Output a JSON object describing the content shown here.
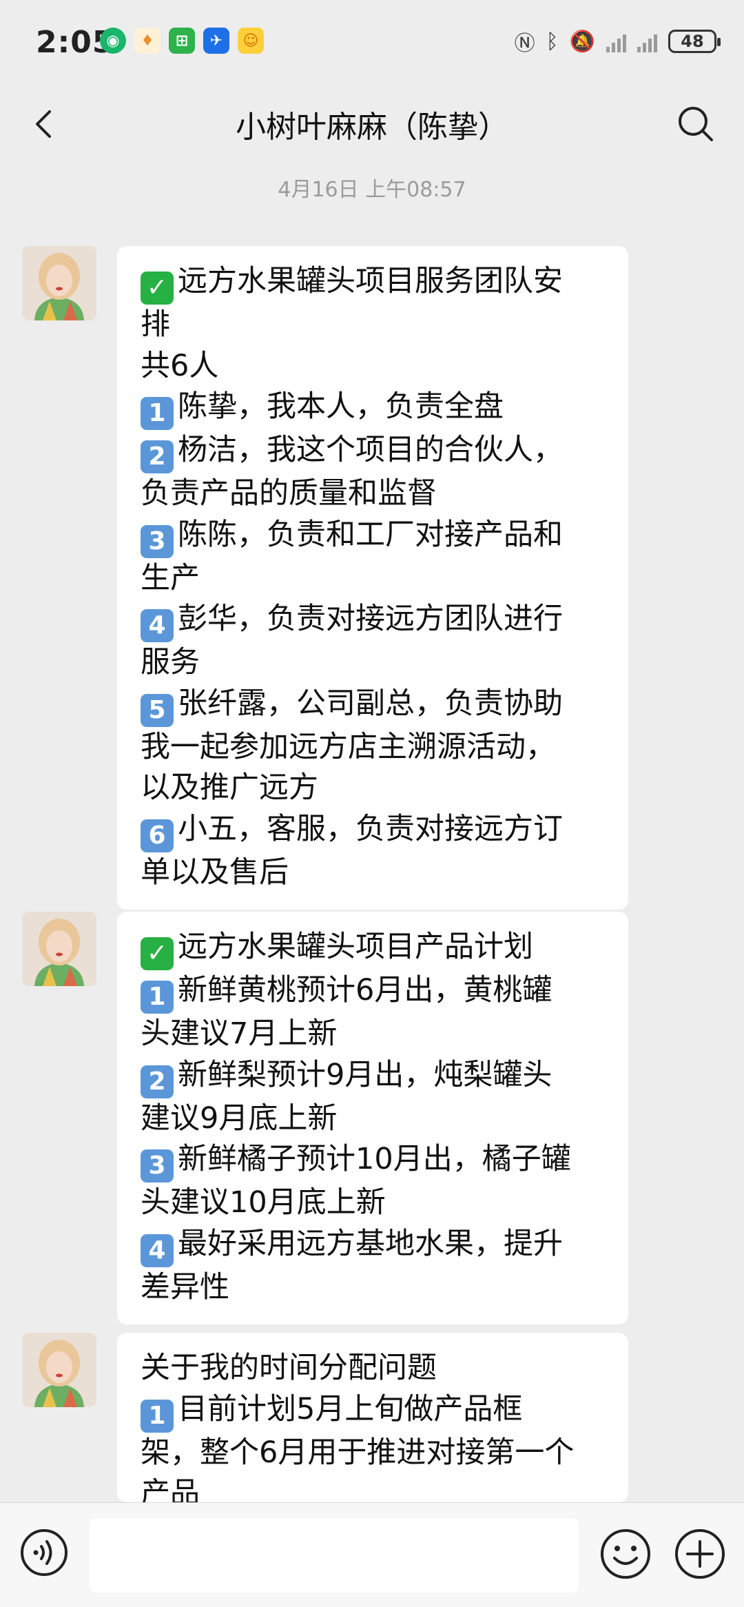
{
  "status_bar": {
    "time": "2:05",
    "battery": "48",
    "app_icons": [
      "green-circle-app-icon",
      "gold-app-icon",
      "green-app-icon",
      "blue-plane-app-icon",
      "yellow-app-icon"
    ]
  },
  "header": {
    "title": "小树叶麻麻（陈挚）"
  },
  "timestamp": "4月16日 上午08:57",
  "messages": [
    {
      "lines": [
        {
          "icon": "✓",
          "kind": "check",
          "text": "远方水果罐头项目服务团队安"
        },
        {
          "text": "排"
        },
        {
          "text": "共6人"
        },
        {
          "icon": "1",
          "kind": "num",
          "text": "陈挚，我本人，负责全盘"
        },
        {
          "icon": "2",
          "kind": "num",
          "text": "杨洁，我这个项目的合伙人，"
        },
        {
          "text": "负责产品的质量和监督"
        },
        {
          "icon": "3",
          "kind": "num",
          "text": "陈陈，负责和工厂对接产品和"
        },
        {
          "text": "生产"
        },
        {
          "icon": "4",
          "kind": "num",
          "text": "彭华，负责对接远方团队进行"
        },
        {
          "text": "服务"
        },
        {
          "icon": "5",
          "kind": "num",
          "text": "张纤露，公司副总，负责协助"
        },
        {
          "text": "我一起参加远方店主溯源活动，"
        },
        {
          "text": "以及推广远方"
        },
        {
          "icon": "6",
          "kind": "num",
          "text": "小五，客服，负责对接远方订"
        },
        {
          "text": "单以及售后"
        }
      ]
    },
    {
      "lines": [
        {
          "icon": "✓",
          "kind": "check",
          "text": "远方水果罐头项目产品计划"
        },
        {
          "icon": "1",
          "kind": "num",
          "text": "新鲜黄桃预计6月出，黄桃罐"
        },
        {
          "text": "头建议7月上新"
        },
        {
          "icon": "2",
          "kind": "num",
          "text": "新鲜梨预计9月出，炖梨罐头"
        },
        {
          "text": "建议9月底上新"
        },
        {
          "icon": "3",
          "kind": "num",
          "text": "新鲜橘子预计10月出，橘子罐"
        },
        {
          "text": "头建议10月底上新"
        },
        {
          "icon": "4",
          "kind": "num",
          "text": "最好采用远方基地水果，提升"
        },
        {
          "text": "差异性"
        }
      ]
    },
    {
      "lines": [
        {
          "text": "关于我的时间分配问题"
        },
        {
          "icon": "1",
          "kind": "num",
          "text": "目前计划5月上旬做产品框"
        },
        {
          "text": "架，整个6月用于推进对接第一个"
        },
        {
          "text": "产品"
        }
      ]
    }
  ],
  "input_bar": {
    "icons": [
      "voice-icon",
      "emoji-icon",
      "plus-icon"
    ],
    "text_value": ""
  }
}
